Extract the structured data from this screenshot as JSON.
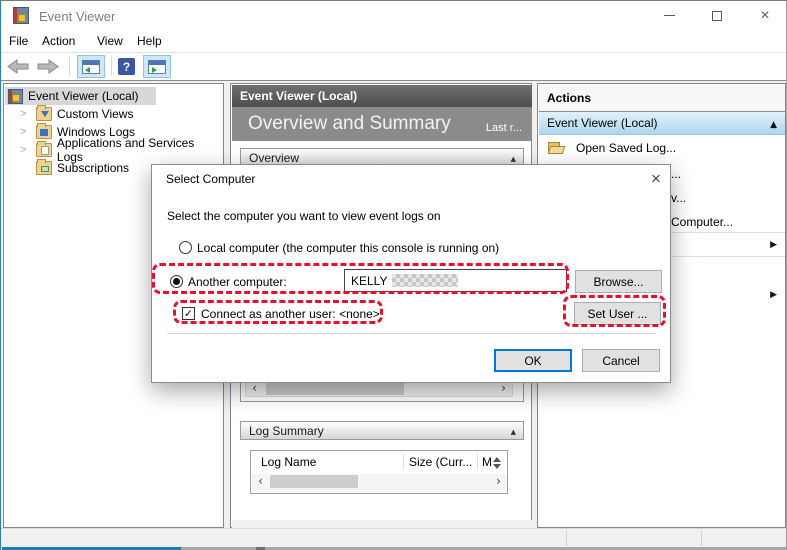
{
  "window": {
    "title": "Event Viewer"
  },
  "menu": {
    "file": "File",
    "action": "Action",
    "view": "View",
    "help": "Help"
  },
  "tree": {
    "root": "Event Viewer (Local)",
    "items": [
      {
        "label": "Custom Views"
      },
      {
        "label": "Windows Logs"
      },
      {
        "label": "Applications and Services Logs"
      },
      {
        "label": "Subscriptions"
      }
    ]
  },
  "center": {
    "header": "Event Viewer (Local)",
    "title": "Overview and Summary",
    "subtitle_right": "Last r...",
    "overview_section": "Overview",
    "log_summary_section": "Log Summary",
    "table": {
      "col1": "Log Name",
      "col2": "Size (Curr...",
      "col3": "M"
    }
  },
  "actions": {
    "header": "Actions",
    "group": "Event Viewer (Local)",
    "item_open_saved_log": "Open Saved Log...",
    "fragment1": "...",
    "fragment2": "v...",
    "fragment3": "Computer..."
  },
  "dialog": {
    "title": "Select Computer",
    "instruction": "Select the computer you want to view event logs on",
    "radio_local": "Local computer (the computer this console is running on)",
    "radio_another": "Another computer:",
    "computer_value": "KELLY",
    "browse": "Browse...",
    "checkbox": "Connect as another user: <none>",
    "set_user": "Set User ...",
    "ok": "OK",
    "cancel": "Cancel"
  },
  "colors": {
    "annotation_red": "#e8112d",
    "default_button_border": "#0078d7"
  }
}
